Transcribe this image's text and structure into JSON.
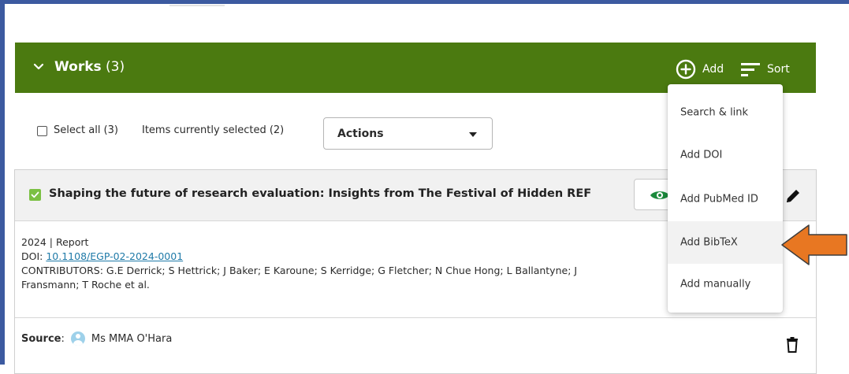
{
  "works_header": {
    "title": "Works",
    "count": "(3)",
    "add_label": "Add",
    "sort_label": "Sort",
    "background": "#4b7a10"
  },
  "selection": {
    "select_all_label": "Select all (3)",
    "items_selected_label": "Items currently selected (2)",
    "actions_label": "Actions"
  },
  "work": {
    "title": "Shaping the future of research evaluation: Insights from The Festival of Hidden REF",
    "year_type": "2024 | Report",
    "doi_prefix": "DOI: ",
    "doi": "10.1108/EGP-02-2024-0001",
    "contributors_line1": "CONTRIBUTORS: G.E Derrick; S Hettrick; J Baker; E Karoune; S Kerridge; G Fletcher; N Chue Hong; L Ballantyne; J",
    "contributors_line2": "Fransmann; T Roche et al.",
    "source_label": "Source",
    "source_sep": ":",
    "source_name": "Ms MMA O'Hara",
    "checkbox_color": "#7bc043",
    "doi_link_color": "#1f7aa8"
  },
  "add_menu": {
    "items": [
      {
        "label": "Search & link"
      },
      {
        "label": "Add DOI"
      },
      {
        "label": "Add PubMed ID"
      },
      {
        "label": "Add BibTeX",
        "highlighted": true
      },
      {
        "label": "Add manually"
      }
    ]
  },
  "annotation": {
    "arrow_color": "#e87722",
    "arrow_target": "Add BibTeX"
  },
  "icons": {
    "header_chevron": "chevron-down-icon",
    "add": "plus-circle-icon",
    "sort": "sort-icon",
    "view": "eye-icon",
    "edit": "pencil-icon",
    "delete": "trash-icon",
    "avatar": "user-avatar-icon"
  }
}
